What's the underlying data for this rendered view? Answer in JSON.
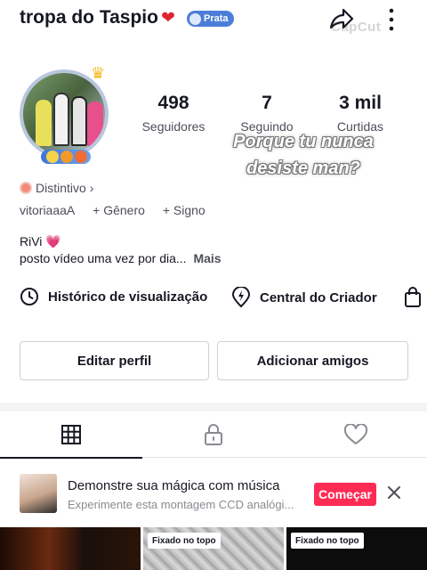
{
  "header": {
    "username": "tropa do Taspio",
    "heart": "❤",
    "badge_label": "Prata",
    "watermark": "CapCut",
    "icons": [
      "share-icon",
      "more-vertical-icon"
    ]
  },
  "profile": {
    "stats": [
      {
        "value": "498",
        "label": "Seguidores"
      },
      {
        "value": "7",
        "label": "Seguindo"
      },
      {
        "value": "3 mil",
        "label": "Curtidas"
      }
    ],
    "overlay_caption_line1": "Porque tu nunca",
    "overlay_caption_line2": "desiste man?",
    "distintivo": "Distintivo",
    "meta": {
      "handle": "vitoriaaaA",
      "gender": "+ Gênero",
      "sign": "+ Signo"
    },
    "bio_line1": "RiVi",
    "bio_heart": "💗",
    "bio_line2": "posto vídeo uma vez por dia...",
    "bio_more": "Mais"
  },
  "shortcuts": [
    {
      "label": "Histórico de visualização",
      "icon": "clock-icon"
    },
    {
      "label": "Central do Criador",
      "icon": "lightning-icon"
    },
    {
      "label": "",
      "icon": "shopping-bag-icon"
    }
  ],
  "actions": {
    "edit_profile": "Editar perfil",
    "add_friends": "Adicionar amigos"
  },
  "tabs": [
    {
      "icon": "grid-icon",
      "active": true
    },
    {
      "icon": "lock-icon",
      "active": false
    },
    {
      "icon": "heart-outline-icon",
      "active": false
    }
  ],
  "promo": {
    "title": "Demonstre sua mágica com música",
    "subtitle": "Experimente esta montagem CCD analógi...",
    "cta": "Começar"
  },
  "videos": [
    {
      "pinned": false,
      "pin_label": ""
    },
    {
      "pinned": true,
      "pin_label": "Fixado no topo"
    },
    {
      "pinned": true,
      "pin_label": "Fixado no topo"
    }
  ],
  "colors": {
    "accent": "#fe2c55",
    "badge": "#4b7ed8",
    "text_primary": "#161823",
    "text_secondary": "#4d4f59"
  }
}
